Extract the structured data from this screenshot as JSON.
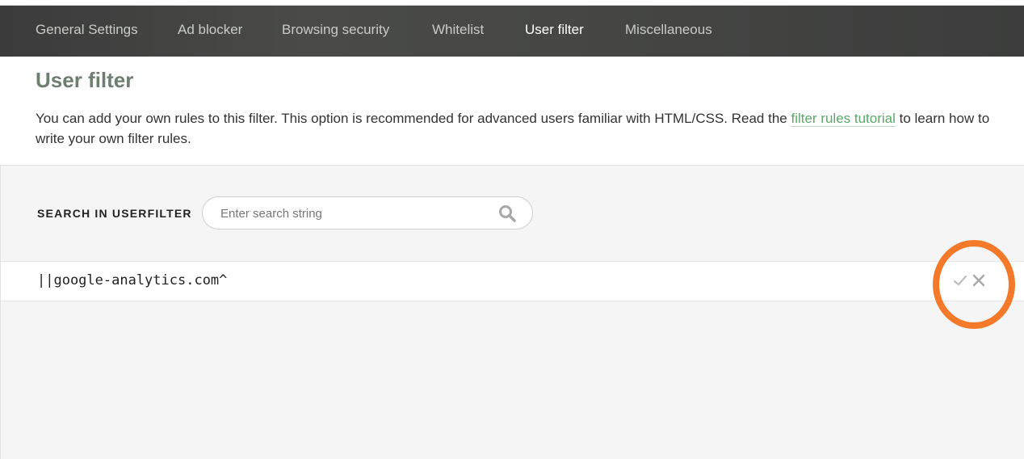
{
  "nav": {
    "items": [
      {
        "label": "General Settings",
        "active": false
      },
      {
        "label": "Ad blocker",
        "active": false
      },
      {
        "label": "Browsing security",
        "active": false
      },
      {
        "label": "Whitelist",
        "active": false
      },
      {
        "label": "User filter",
        "active": true
      },
      {
        "label": "Miscellaneous",
        "active": false
      }
    ]
  },
  "page": {
    "title": "User filter",
    "description_before": "You can add your own rules to this filter. This option is recommended for advanced users familiar with HTML/CSS. Read the ",
    "description_link": "filter rules tutorial",
    "description_after": " to learn how to write your own filter rules."
  },
  "search": {
    "label": "SEARCH IN USERFILTER",
    "placeholder": "Enter search string",
    "value": ""
  },
  "rules": [
    {
      "text": "||google-analytics.com^"
    }
  ],
  "icons": {
    "search": "search-icon",
    "confirm": "check-icon",
    "delete": "close-icon"
  },
  "colors": {
    "nav_bg": "#444543",
    "title": "#6e7f70",
    "link": "#5aa968",
    "highlight": "#f47a2a"
  }
}
